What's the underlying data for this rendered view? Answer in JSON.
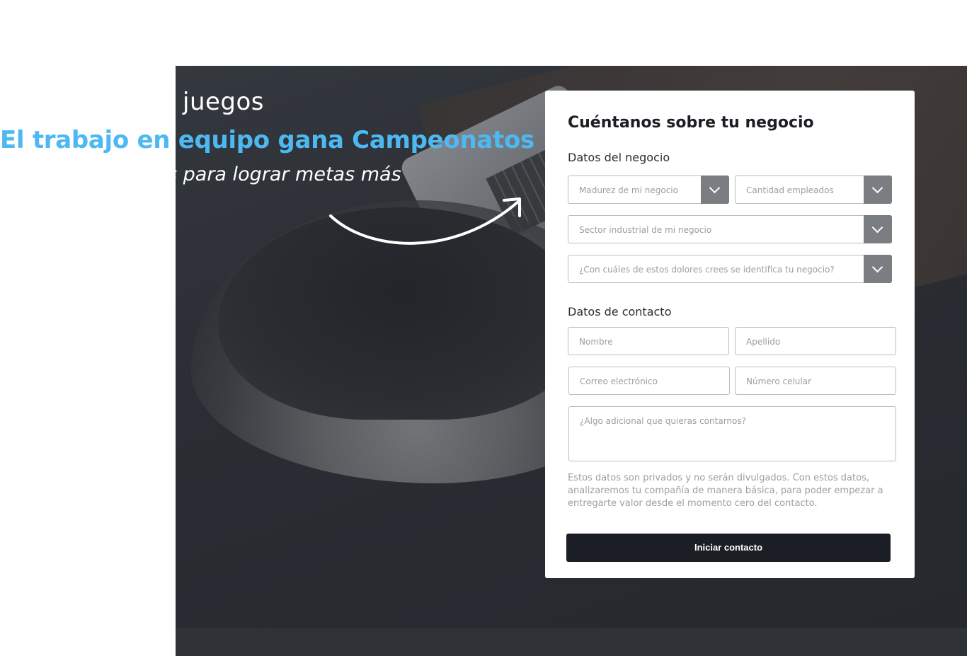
{
  "hero": {
    "line1": "juegos",
    "headline": "El trabajo en equipo gana Campeonatos",
    "line3": "s para lograr metas más",
    "headline_color": "#4db8f2"
  },
  "form": {
    "title": "Cuéntanos sobre tu negocio",
    "business_section": "Datos del negocio",
    "contact_section": "Datos de contacto",
    "selects": {
      "maturity": "Madurez de mi negocio",
      "employees": "Cantidad empleados",
      "sector": "Sector industrial de mi negocio",
      "pains": "¿Con cuáles de estos dolores crees se identifica tu negocio?"
    },
    "inputs": {
      "first_name": "Nombre",
      "last_name": "Apellido",
      "email": "Correo electrónico",
      "phone": "Número celular",
      "message": "¿Algo adicional que quieras contarnos?"
    },
    "privacy_note": "Estos datos son privados y no serán divulgados. Con estos datos, analizaremos tu compañía de manera básica, para poder empezar a entregarte valor desde el momento cero del contacto.",
    "submit_label": "Iniciar contacto",
    "submit_color": "#1c1e26"
  }
}
